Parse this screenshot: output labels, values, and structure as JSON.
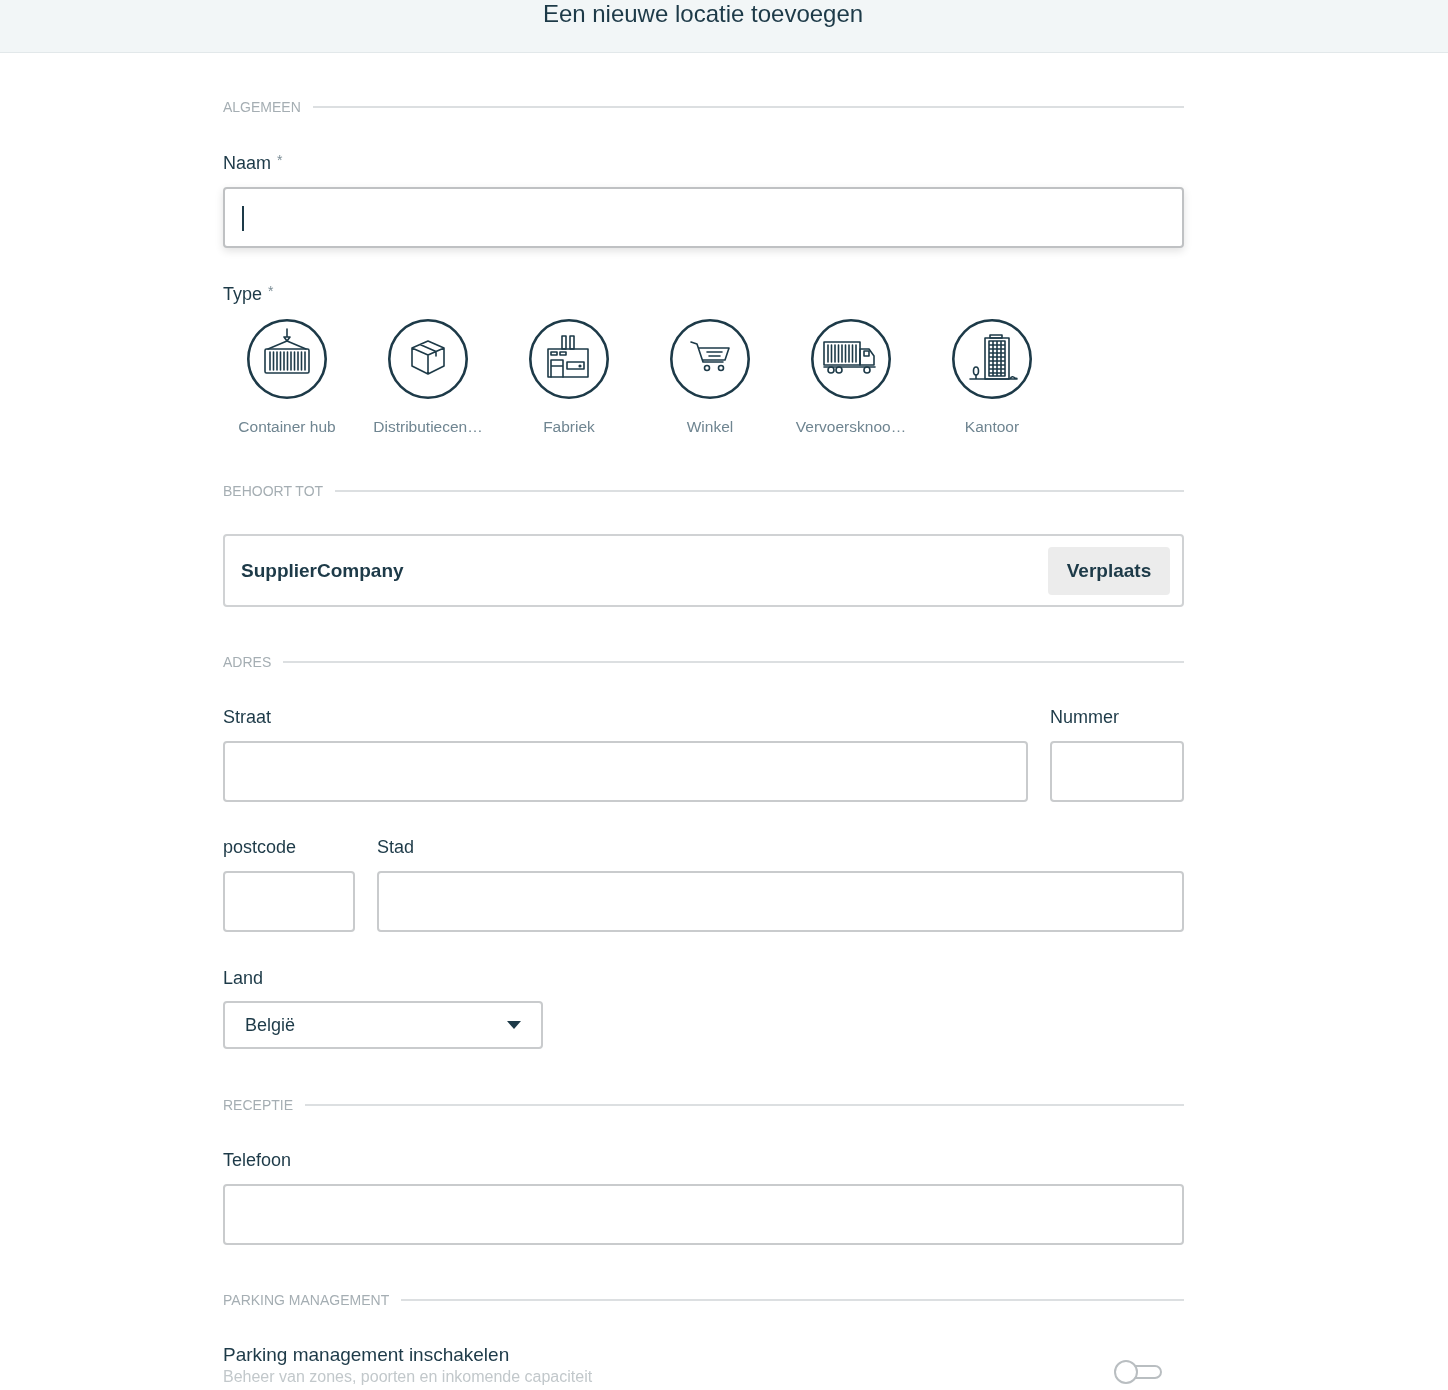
{
  "header": {
    "title": "Een nieuwe locatie toevoegen"
  },
  "general": {
    "heading": "ALGEMEEN",
    "name_field": {
      "label": "Naam",
      "required_mark": "*",
      "focused": true
    },
    "type_field": {
      "label": "Type",
      "required_mark": "*",
      "options": [
        {
          "kind": "container",
          "label": "Container hub",
          "selected": false
        },
        {
          "kind": "package",
          "label": "Distributiecen…",
          "selected": false
        },
        {
          "kind": "factory",
          "label": "Fabriek",
          "selected": false
        },
        {
          "kind": "cart",
          "label": "Winkel",
          "selected": false
        },
        {
          "kind": "truck",
          "label": "Vervoersknoo…",
          "selected": false
        },
        {
          "kind": "building",
          "label": "Kantoor",
          "selected": false
        }
      ]
    }
  },
  "belongs_to": {
    "heading": "BEHOORT TOT",
    "value": "SupplierCompany",
    "button": "Verplaats"
  },
  "address": {
    "heading": "ADRES",
    "rows": [
      [
        {
          "label": "Straat"
        },
        {
          "label": "Nummer"
        }
      ],
      [
        {
          "label": "postcode"
        },
        {
          "label": "Stad"
        }
      ]
    ],
    "country": {
      "label": "Land",
      "value": "België"
    }
  },
  "reception": {
    "heading": "RECEPTIE",
    "phone": {
      "label": "Telefoon"
    }
  },
  "parking": {
    "heading": "PARKING MANAGEMENT",
    "toggle": {
      "label": "Parking management inschakelen",
      "description": "Beheer van zones, poorten en inkomende capaciteit",
      "on": false
    }
  }
}
